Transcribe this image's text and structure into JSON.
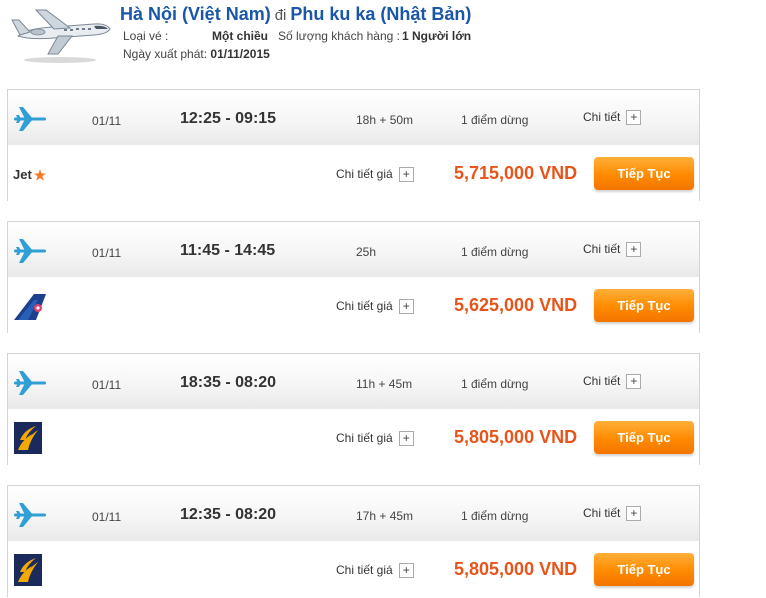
{
  "header": {
    "origin": "Hà Nội (Việt Nam)",
    "connector": "đi",
    "destination": "Phu ku ka (Nhật Bản)",
    "ticket_type_label": "Loại vé :",
    "ticket_type_value": "Một chiều",
    "passengers_label": "Số lượng khách hàng :",
    "passengers_value": "1 Người lớn",
    "departure_label": "Ngày xuất phát:",
    "departure_value": "01/11/2015"
  },
  "labels": {
    "detail": "Chi tiết",
    "price_detail": "Chi tiết giá",
    "continue": "Tiếp Tục",
    "plus": "+"
  },
  "colors": {
    "route": "#1a57a8",
    "price": "#e8541a",
    "button": "#ff8a00",
    "plane_icon": "#2f9fd6"
  },
  "flights": [
    {
      "date": "01/11",
      "times": "12:25 - 09:15",
      "duration": "18h + 50m",
      "stops": "1 điểm dừng",
      "price": "5,715,000 VND",
      "airline_logo": "jetstar-logo",
      "airline_logo_text": "Jet"
    },
    {
      "date": "01/11",
      "times": "11:45 - 14:45",
      "duration": "25h",
      "stops": "1 điểm dừng",
      "price": "5,625,000 VND",
      "airline_logo": "china-airlines-logo"
    },
    {
      "date": "01/11",
      "times": "18:35 - 08:20",
      "duration": "11h + 45m",
      "stops": "1 điểm dừng",
      "price": "5,805,000 VND",
      "airline_logo": "singapore-airlines-logo"
    },
    {
      "date": "01/11",
      "times": "12:35 - 08:20",
      "duration": "17h + 45m",
      "stops": "1 điểm dừng",
      "price": "5,805,000 VND",
      "airline_logo": "singapore-airlines-logo"
    }
  ]
}
